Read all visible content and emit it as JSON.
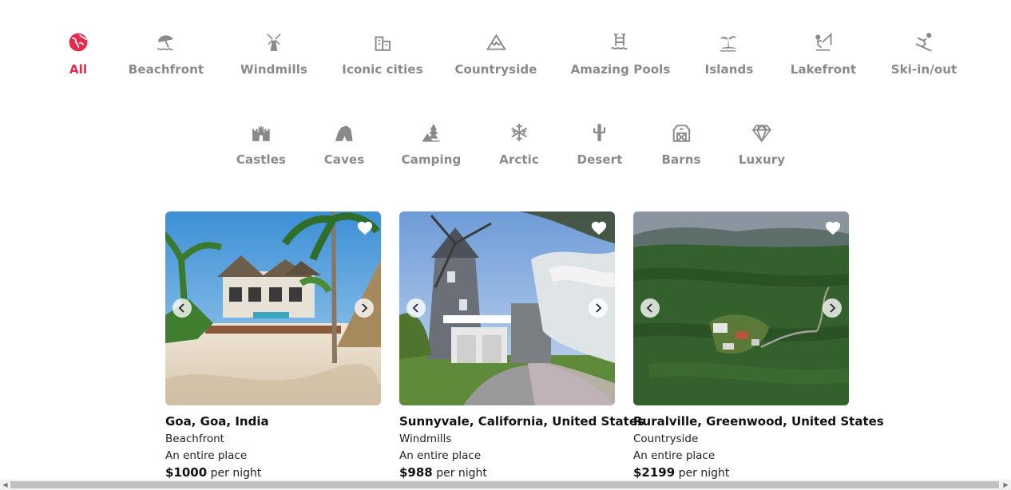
{
  "categories_row1": [
    {
      "label": "All",
      "icon": "globe-icon"
    },
    {
      "label": "Beachfront",
      "icon": "beach-umbrella-icon"
    },
    {
      "label": "Windmills",
      "icon": "windmill-icon"
    },
    {
      "label": "Iconic cities",
      "icon": "city-building-icon"
    },
    {
      "label": "Countryside",
      "icon": "mountain-icon"
    },
    {
      "label": "Amazing Pools",
      "icon": "pool-ladder-icon"
    },
    {
      "label": "Islands",
      "icon": "palm-island-icon"
    },
    {
      "label": "Lakefront",
      "icon": "fishing-icon"
    },
    {
      "label": "Ski-in/out",
      "icon": "skier-icon"
    }
  ],
  "categories_row2": [
    {
      "label": "Castles",
      "icon": "castle-icon"
    },
    {
      "label": "Caves",
      "icon": "cave-icon"
    },
    {
      "label": "Camping",
      "icon": "tent-tree-icon"
    },
    {
      "label": "Arctic",
      "icon": "snowflake-icon"
    },
    {
      "label": "Desert",
      "icon": "cactus-icon"
    },
    {
      "label": "Barns",
      "icon": "barn-icon"
    },
    {
      "label": "Luxury",
      "icon": "diamond-icon"
    }
  ],
  "active_category": "All",
  "colors": {
    "accent": "#e8284d",
    "muted": "#8a8a8a"
  },
  "listings": [
    {
      "location": "Goa, Goa, India",
      "category": "Beachfront",
      "type": "An entire place",
      "price": "$1000",
      "per": "per night",
      "scene": "beach-villa"
    },
    {
      "location": "Sunnyvale, California, United States",
      "category": "Windmills",
      "type": "An entire place",
      "price": "$988",
      "per": "per night",
      "scene": "windmill-house"
    },
    {
      "location": "Ruralville, Greenwood, United States",
      "category": "Countryside",
      "type": "An entire place",
      "price": "$2199",
      "per": "per night",
      "scene": "forest-aerial"
    }
  ]
}
